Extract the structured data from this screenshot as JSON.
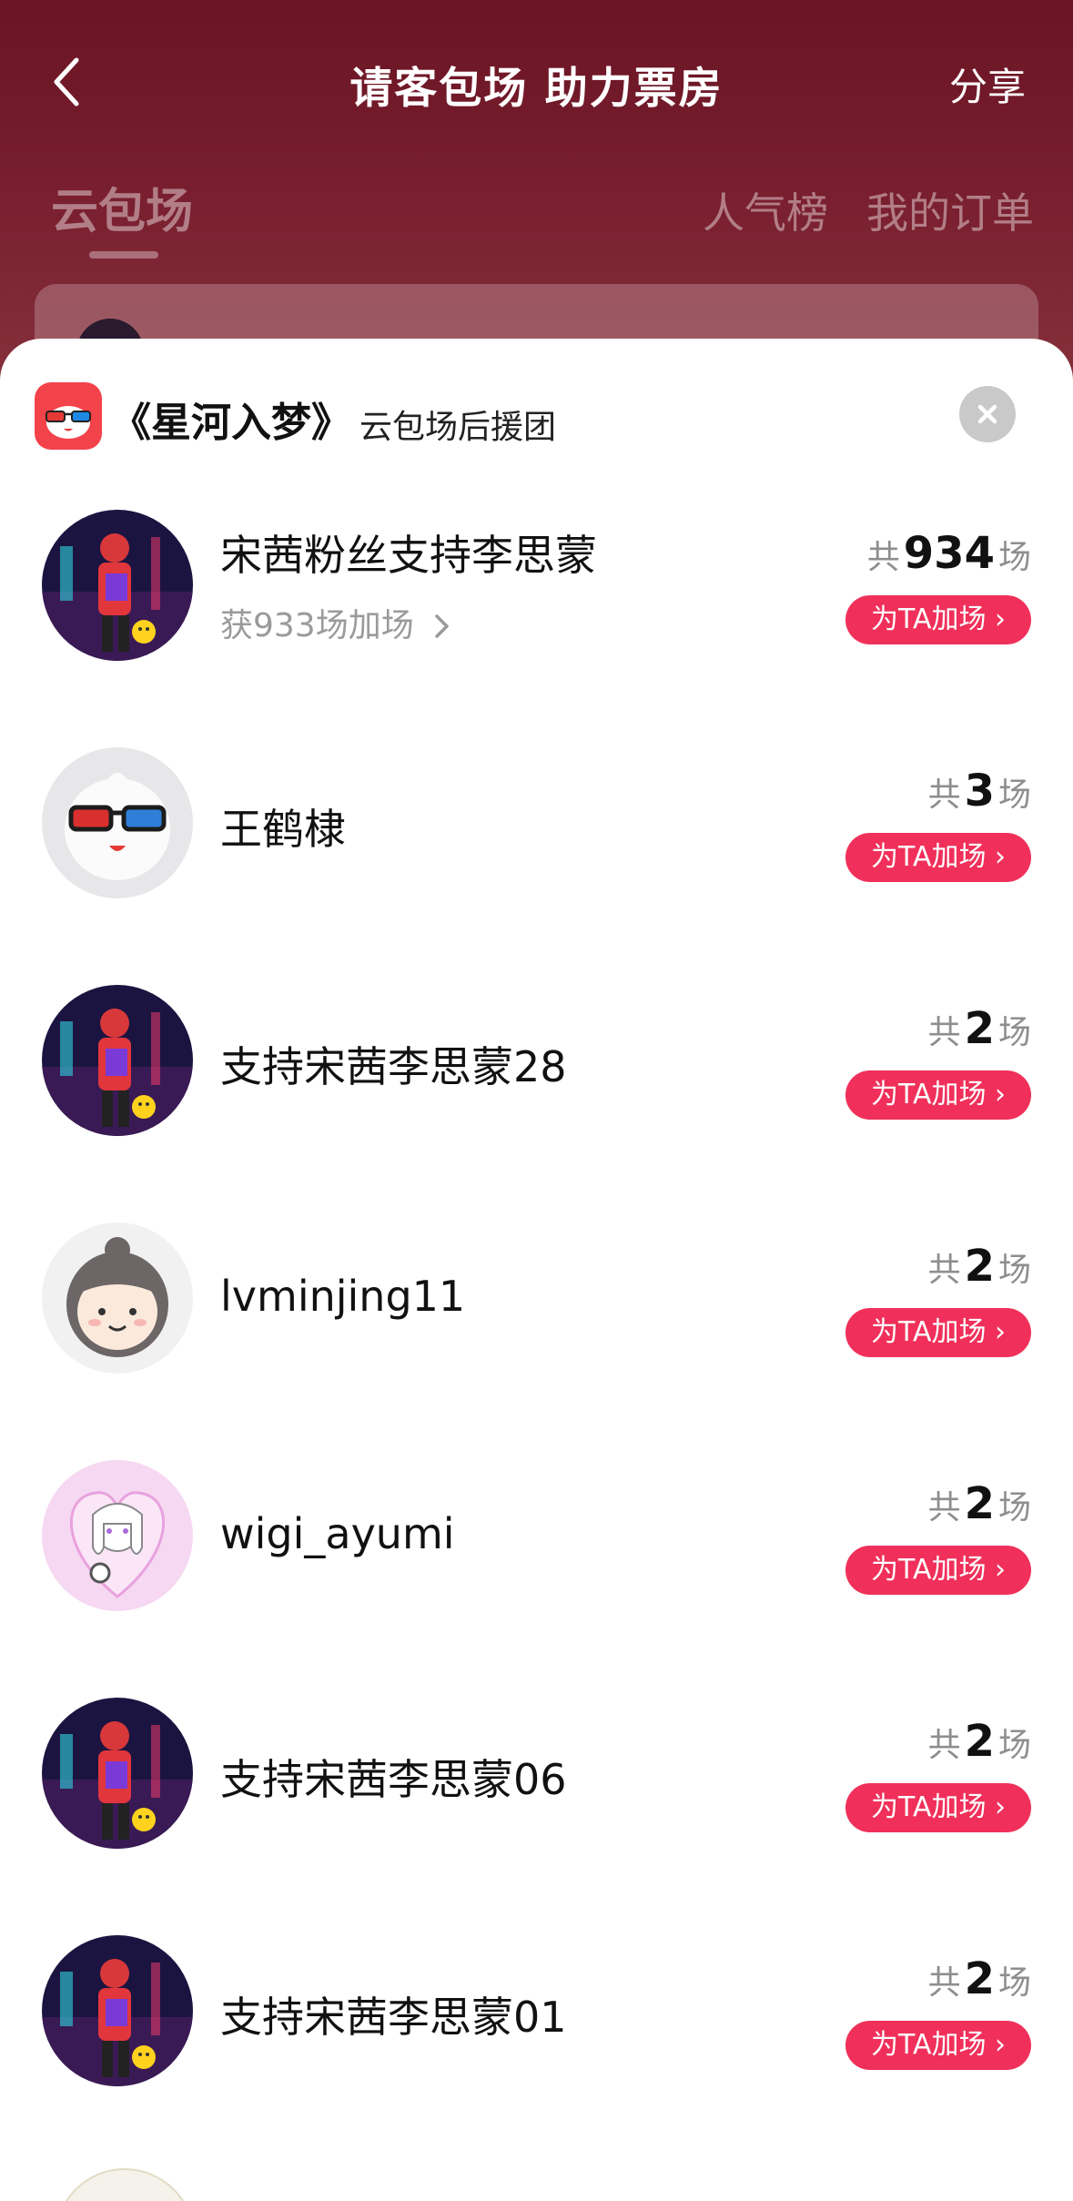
{
  "header": {
    "title": "请客包场 助力票房",
    "share_label": "分享"
  },
  "tabs": {
    "cloud": "云包场",
    "popular": "人气榜",
    "orders": "我的订单"
  },
  "sheet": {
    "movie_title": "《星河入梦》",
    "subtitle": "云包场后援团"
  },
  "rows": [
    {
      "name": "宋茜粉丝支持李思蒙",
      "sub": "获933场加场",
      "count_prefix": "共",
      "count": "934",
      "count_suffix": "场",
      "button": "为TA加场 ›",
      "avatar": "poster-avatar"
    },
    {
      "name": "王鹤棣",
      "count_prefix": "共",
      "count": "3",
      "count_suffix": "场",
      "button": "为TA加场 ›",
      "avatar": "mascot-avatar"
    },
    {
      "name": "支持宋茜李思蒙28",
      "count_prefix": "共",
      "count": "2",
      "count_suffix": "场",
      "button": "为TA加场 ›",
      "avatar": "poster-avatar"
    },
    {
      "name": "lvminjing11",
      "count_prefix": "共",
      "count": "2",
      "count_suffix": "场",
      "button": "为TA加场 ›",
      "avatar": "girl-avatar"
    },
    {
      "name": "wigi_ayumi",
      "count_prefix": "共",
      "count": "2",
      "count_suffix": "场",
      "button": "为TA加场 ›",
      "avatar": "anime-avatar"
    },
    {
      "name": "支持宋茜李思蒙06",
      "count_prefix": "共",
      "count": "2",
      "count_suffix": "场",
      "button": "为TA加场 ›",
      "avatar": "poster-avatar"
    },
    {
      "name": "支持宋茜李思蒙01",
      "count_prefix": "共",
      "count": "2",
      "count_suffix": "场",
      "button": "为TA加场 ›",
      "avatar": "poster-avatar"
    }
  ],
  "colors": {
    "header_bg": "#6a1424",
    "accent": "#f0305a",
    "logo": "#f2424a"
  }
}
